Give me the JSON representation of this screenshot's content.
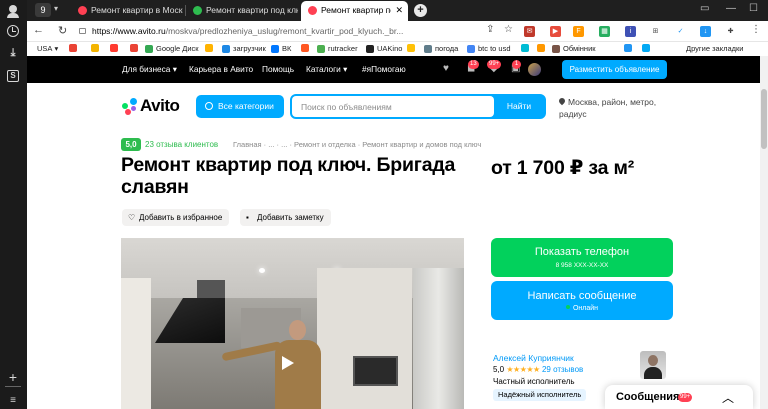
{
  "browser": {
    "tab_counter": "9",
    "tabs": [
      {
        "title": "Ремонт квартир в Москве",
        "favicon_color": "#ff4053"
      },
      {
        "title": "Ремонт квартир под ключ",
        "favicon_color": "#2ebc4f"
      },
      {
        "title": "Ремонт квартир под кл",
        "favicon_color": "#ff4053"
      }
    ],
    "url_host": "https://www.avito.ru",
    "url_path": "/moskva/predlozheniya_uslug/remont_kvartir_pod_klyuch._br...",
    "bookmarks": [
      {
        "label": "USA",
        "color": "#ffffff"
      },
      {
        "label": "",
        "color": "#ea4335"
      },
      {
        "label": "",
        "color": "#f4b400"
      },
      {
        "label": "",
        "color": "#ff3b30"
      },
      {
        "label": "",
        "color": "#fbbc05"
      },
      {
        "label": "",
        "color": "#ea4335"
      },
      {
        "label": "Google Диск",
        "color": "#34a853"
      },
      {
        "label": "",
        "color": "#ffb300"
      },
      {
        "label": "загрузчик",
        "color": "#1e88e5"
      },
      {
        "label": "ВК",
        "color": "#0077ff"
      },
      {
        "label": "",
        "color": "#ff5722"
      },
      {
        "label": "rutracker",
        "color": "#4caf50"
      },
      {
        "label": "UAKino",
        "color": "#222222"
      },
      {
        "label": "",
        "color": "#ffc107"
      },
      {
        "label": "погода",
        "color": "#607d8b"
      },
      {
        "label": "btc to usd",
        "color": "#4285f4"
      },
      {
        "label": "",
        "color": "#00bcd4"
      },
      {
        "label": "",
        "color": "#ff9800"
      },
      {
        "label": "Обмінник",
        "color": "#795548"
      },
      {
        "label": "",
        "color": "#2196f3"
      },
      {
        "label": "",
        "color": "#03a9f4"
      }
    ],
    "other_bookmarks": "Другие закладки"
  },
  "nav": {
    "business": "Для бизнеса",
    "career": "Карьера в Авито",
    "help": "Помощь",
    "catalogs": "Каталоги",
    "help_tag": "#яПомогаю",
    "badge_messages": "13",
    "badge_notifications": "99+",
    "badge_cart": "1",
    "post_ad": "Разместить объявление"
  },
  "header": {
    "logo": "Avito",
    "categories_button": "Все категории",
    "search_placeholder": "Поиск по объявлениям",
    "search_button": "Найти",
    "location": "Москва, район, метро, радиус"
  },
  "listing": {
    "rating": "5,0",
    "reviews_link": "23 отзыва клиентов",
    "breadcrumbs": "Главная  ·  ...  ·  ...  ·  Ремонт и отделка  ·  Ремонт квартир и домов под ключ",
    "title": "Ремонт квартир под ключ. Бригада славян",
    "price": "от 1 700 ₽ за м²",
    "favorite": "Добавить в избранное",
    "note": "Добавить заметку"
  },
  "contact": {
    "show_phone": "Показать телефон",
    "phone_mask": "8 958 XXX-XX-XX",
    "write_message": "Написать сообщение",
    "online": "Онлайн"
  },
  "seller": {
    "name": "Алексей Куприянчик",
    "rating": "5,0",
    "stars": "★★★★★",
    "reviews": "29 отзывов",
    "type": "Частный исполнитель",
    "badge": "Надёжный исполнитель"
  },
  "messages": {
    "label": "Сообщения",
    "count": "99+"
  }
}
